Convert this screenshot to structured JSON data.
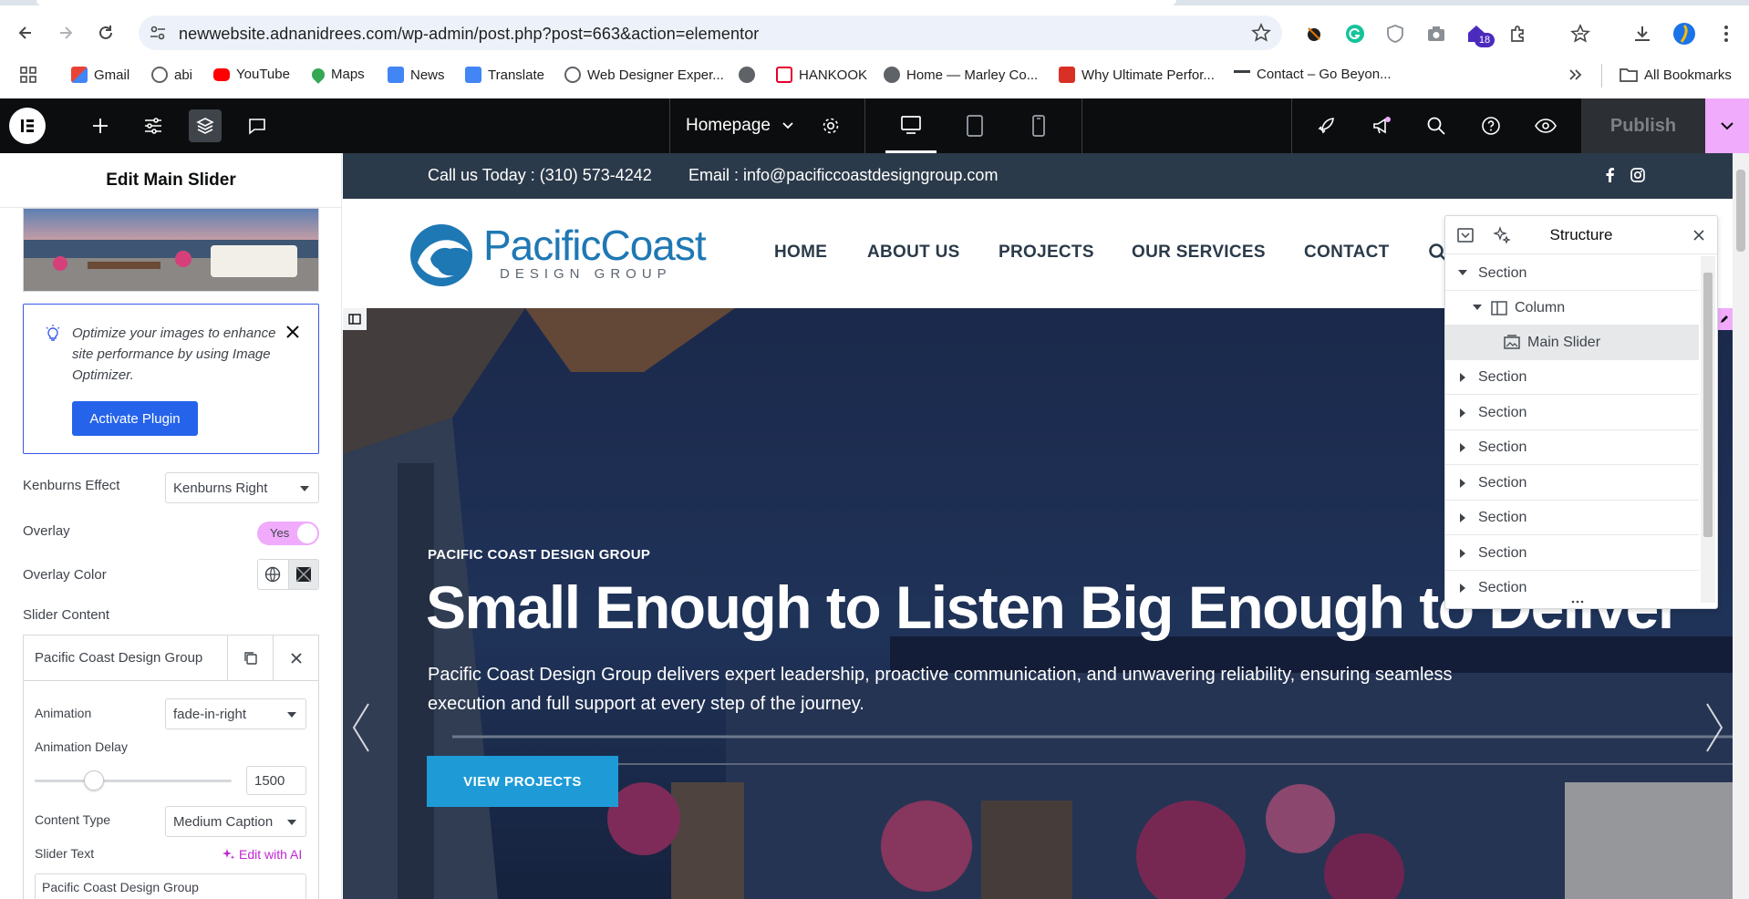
{
  "browser": {
    "url": "newwebsite.adnanidrees.com/wp-admin/post.php?post=663&action=elementor",
    "extension_badge": "18",
    "bookmarks": [
      {
        "label": "Gmail",
        "color": "#ea4335"
      },
      {
        "label": "abi",
        "color": "#5f6368"
      },
      {
        "label": "YouTube",
        "color": "#ff0000"
      },
      {
        "label": "Maps",
        "color": "#34a853"
      },
      {
        "label": "News",
        "color": "#4285f4"
      },
      {
        "label": "Translate",
        "color": "#4285f4"
      },
      {
        "label": "Web Designer Exper...",
        "color": "#5f6368"
      },
      {
        "label": "",
        "color": "#5f6368"
      },
      {
        "label": "HANKOOK",
        "color": "#e8002d"
      },
      {
        "label": "Home — Marley Co...",
        "color": "#5f6368"
      },
      {
        "label": "Why Ultimate Perfor...",
        "color": "#d93025"
      },
      {
        "label": "Contact – Go Beyon...",
        "color": "#3c4043"
      }
    ],
    "all_bookmarks": "All Bookmarks"
  },
  "editor": {
    "page_name": "Homepage",
    "publish": "Publish",
    "accent": "#f0abfc"
  },
  "panel": {
    "title": "Edit Main Slider",
    "notice": "Optimize your images to enhance site performance by using Image Optimizer.",
    "activate": "Activate Plugin",
    "kenburns_label": "Kenburns Effect",
    "kenburns_value": "Kenburns Right",
    "overlay_label": "Overlay",
    "overlay_value": "Yes",
    "overlay_color_label": "Overlay Color",
    "slider_content_label": "Slider Content",
    "item_title": "Pacific Coast Design Group",
    "animation_label": "Animation",
    "animation_value": "fade-in-right",
    "delay_label": "Animation Delay",
    "delay_value": "1500",
    "delay_fraction": 0.3,
    "content_type_label": "Content Type",
    "content_type_value": "Medium Caption",
    "slider_text_label": "Slider Text",
    "edit_ai": "Edit with AI",
    "slider_text_value": "Pacific Coast Design Group"
  },
  "site": {
    "phone": "Call us Today : (310) 573-4242",
    "email": "Email : info@pacificcoastdesigngroup.com",
    "logo_main": "PacificCoast",
    "logo_sub": "DESIGN GROUP",
    "nav": [
      "HOME",
      "ABOUT US",
      "PROJECTS",
      "OUR SERVICES",
      "CONTACT"
    ],
    "hero_kicker": "PACIFIC COAST DESIGN GROUP",
    "hero_heading": "Small Enough to Listen Big Enough to Deliver",
    "hero_text": "Pacific Coast Design Group delivers expert leadership, proactive communication, and unwavering reliability, ensuring seamless execution and full support at every step of the journey.",
    "hero_button": "VIEW PROJECTS"
  },
  "structure": {
    "title": "Structure",
    "rows": [
      {
        "label": "Section",
        "level": 0,
        "state": "open"
      },
      {
        "label": "Column",
        "level": 1,
        "state": "open"
      },
      {
        "label": "Main Slider",
        "level": 2,
        "state": "leaf"
      },
      {
        "label": "Section",
        "level": 0,
        "state": "closed"
      },
      {
        "label": "Section",
        "level": 0,
        "state": "closed"
      },
      {
        "label": "Section",
        "level": 0,
        "state": "closed"
      },
      {
        "label": "Section",
        "level": 0,
        "state": "closed"
      },
      {
        "label": "Section",
        "level": 0,
        "state": "closed"
      },
      {
        "label": "Section",
        "level": 0,
        "state": "closed"
      },
      {
        "label": "Section",
        "level": 0,
        "state": "closed"
      }
    ]
  }
}
